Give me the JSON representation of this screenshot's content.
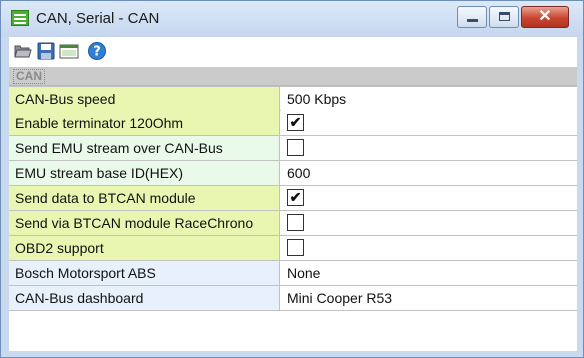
{
  "window": {
    "title": "CAN, Serial - CAN",
    "buttons": {
      "minimize": "minimize",
      "maximize": "maximize",
      "close": "✕"
    }
  },
  "toolbar": {
    "icons": [
      "folder-open-icon",
      "save-icon",
      "window-icon",
      "help-icon"
    ]
  },
  "grid": {
    "category": "CAN",
    "rows": [
      {
        "label": "CAN-Bus speed",
        "type": "text",
        "value": "500 Kbps"
      },
      {
        "label": "Enable terminator 120Ohm",
        "type": "checkbox",
        "checked": true,
        "mark": "✔"
      },
      {
        "label": "Send EMU stream over CAN-Bus",
        "type": "checkbox",
        "checked": false,
        "mark": ""
      },
      {
        "label": "EMU stream base ID(HEX)",
        "type": "text",
        "value": "600"
      },
      {
        "label": "Send data to BTCAN module",
        "type": "checkbox",
        "checked": true,
        "mark": "✔"
      },
      {
        "label": "Send via BTCAN module RaceChrono",
        "type": "checkbox",
        "checked": false,
        "mark": ""
      },
      {
        "label": "OBD2 support",
        "type": "checkbox",
        "checked": false,
        "mark": ""
      },
      {
        "label": "Bosch Motorsport ABS",
        "type": "text",
        "value": "None"
      },
      {
        "label": "CAN-Bus dashboard",
        "type": "text",
        "value": "Mini Cooper R53"
      }
    ]
  },
  "colors": {
    "label_yellow": "#e9f6b2",
    "label_mint": "#e9f9ea",
    "label_blue": "#e8f1fb",
    "category_bg": "#cbcbcb",
    "close_button": "#c8462f"
  }
}
